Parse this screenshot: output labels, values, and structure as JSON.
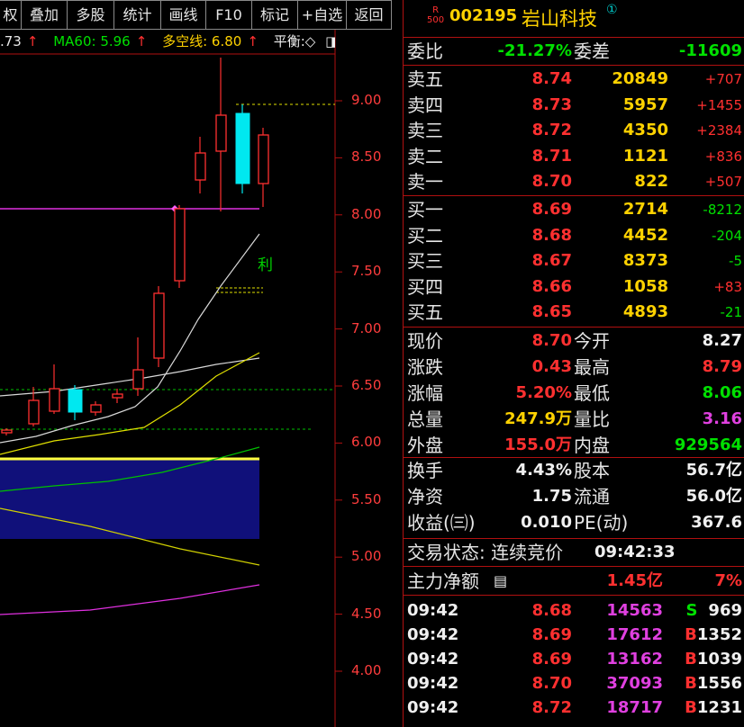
{
  "toolbar": {
    "buttons": [
      "权",
      "叠加",
      "多股",
      "统计",
      "画线",
      "F10",
      "标记",
      "+自选",
      "返回"
    ]
  },
  "ma_bar": {
    "ma_partial": ".73",
    "ma_partial_arrow": "↑",
    "ma60": "MA60: 5.96",
    "ma60_arrow": "↑",
    "duokong": "多空线: 6.80",
    "duokong_arrow": "↑",
    "pingheng": "平衡:◇",
    "menu_icon": "◨"
  },
  "chart": {
    "price_ticks": [
      "9.00",
      "8.50",
      "8.00",
      "7.50",
      "7.00",
      "6.50",
      "6.00",
      "5.50",
      "5.00",
      "4.50",
      "4.00"
    ],
    "signal_label": "利",
    "colors": {
      "up": "#ff3030",
      "down": "#00e8f0",
      "ma_white": "#d8d8d8",
      "ma_yellow": "#e0e000",
      "ma_green": "#00c000",
      "ma_magenta": "#e030e0",
      "band": "#10107a"
    }
  },
  "stock": {
    "badge_top": "R",
    "badge_bottom": "500",
    "code": "002195",
    "name": "岩山科技",
    "info_icon": "①"
  },
  "weibi": {
    "label": "委比",
    "value": "-21.27%",
    "diff_label": "委差",
    "diff_value": "-11609"
  },
  "asks": [
    {
      "label": "卖五",
      "price": "8.74",
      "vol": "20849",
      "chg": "+707"
    },
    {
      "label": "卖四",
      "price": "8.73",
      "vol": "5957",
      "chg": "+1455"
    },
    {
      "label": "卖三",
      "price": "8.72",
      "vol": "4350",
      "chg": "+2384"
    },
    {
      "label": "卖二",
      "price": "8.71",
      "vol": "1121",
      "chg": "+836"
    },
    {
      "label": "卖一",
      "price": "8.70",
      "vol": "822",
      "chg": "+507"
    }
  ],
  "bids": [
    {
      "label": "买一",
      "price": "8.69",
      "vol": "2714",
      "chg": "-8212"
    },
    {
      "label": "买二",
      "price": "8.68",
      "vol": "4452",
      "chg": "-204"
    },
    {
      "label": "买三",
      "price": "8.67",
      "vol": "8373",
      "chg": "-5"
    },
    {
      "label": "买四",
      "price": "8.66",
      "vol": "1058",
      "chg": "+83"
    },
    {
      "label": "买五",
      "price": "8.65",
      "vol": "4893",
      "chg": "-21"
    }
  ],
  "stats": [
    {
      "l1": "现价",
      "v1": "8.70",
      "l2": "今开",
      "v2": "8.27"
    },
    {
      "l1": "涨跌",
      "v1": "0.43",
      "l2": "最高",
      "v2": "8.79"
    },
    {
      "l1": "涨幅",
      "v1": "5.20%",
      "l2": "最低",
      "v2": "8.06"
    },
    {
      "l1": "总量",
      "v1": "247.9万",
      "l2": "量比",
      "v2": "3.16"
    },
    {
      "l1": "外盘",
      "v1": "155.0万",
      "l2": "内盘",
      "v2": "929564"
    }
  ],
  "fundamentals": [
    {
      "l1": "换手",
      "v1": "4.43%",
      "l2": "股本",
      "v2": "56.7亿"
    },
    {
      "l1": "净资",
      "v1": "1.75",
      "l2": "流通",
      "v2": "56.0亿"
    },
    {
      "l1": "收益(㈢)",
      "v1": "0.010",
      "l2": "PE(动)",
      "v2": "367.6"
    }
  ],
  "trade_status": {
    "label": "交易状态: 连续竞价",
    "time": "09:42:33"
  },
  "main_flow": {
    "label": "主力净额",
    "icon": "▤",
    "value": "1.45亿",
    "pct": "7%"
  },
  "ticks": [
    {
      "time": "09:42",
      "price": "8.68",
      "vol": "14563",
      "bs": "S",
      "num": "969"
    },
    {
      "time": "09:42",
      "price": "8.69",
      "vol": "17612",
      "bs": "B",
      "num": "1352"
    },
    {
      "time": "09:42",
      "price": "8.69",
      "vol": "13162",
      "bs": "B",
      "num": "1039"
    },
    {
      "time": "09:42",
      "price": "8.70",
      "vol": "37093",
      "bs": "B",
      "num": "1556"
    },
    {
      "time": "09:42",
      "price": "8.72",
      "vol": "18717",
      "bs": "B",
      "num": "1231"
    }
  ]
}
